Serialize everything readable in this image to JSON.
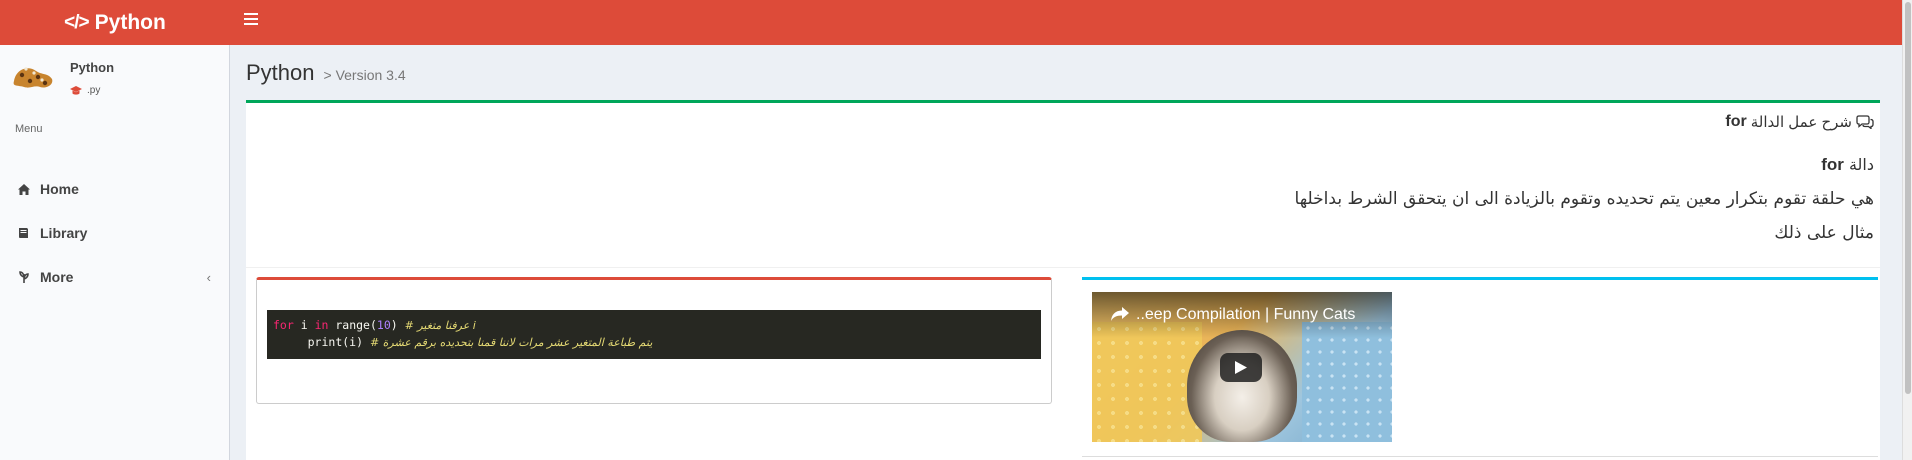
{
  "header": {
    "logo_code": "</>",
    "logo_text": "Python"
  },
  "user": {
    "name": "Python",
    "subtitle": ".py"
  },
  "sidebar": {
    "menu_header": "Menu",
    "items": [
      {
        "label": "Home",
        "icon": "home-icon"
      },
      {
        "label": "Library",
        "icon": "book-icon"
      },
      {
        "label": "More",
        "icon": "leaf-icon",
        "chevron": "‹"
      }
    ]
  },
  "page": {
    "title": "Python",
    "subtitle": "> Version 3.4"
  },
  "main_box": {
    "title_keyword": "for",
    "title_text": "شرح عمل الدالة",
    "line1_text": "دالة",
    "line1_keyword": "for",
    "line2": "هي حلقة تقوم بتكرار معين يتم تحديده وتقوم بالزيادة الى ان يتحقق الشرط بداخلها",
    "line3": "مثال على ذلك"
  },
  "code": {
    "l1_kw1": "for",
    "l1_var": " i ",
    "l1_kw2": "in",
    "l1_fn": " range(",
    "l1_num": "10",
    "l1_close": ") ",
    "l1_comment": "# عرفنا متغير i",
    "l2_indent": "     ",
    "l2_fn": "print(i) ",
    "l2_comment": "# يتم طباعة المتغير عشر مرات لاننا قمنا بتحديده برقم عشرة"
  },
  "video": {
    "title": "..eep Compilation | Funny Cats"
  },
  "colors": {
    "header": "#dd4b39",
    "box_green": "#00a65a",
    "box_red": "#dd4b39",
    "box_blue": "#00c0ef",
    "code_bg": "#272822"
  }
}
